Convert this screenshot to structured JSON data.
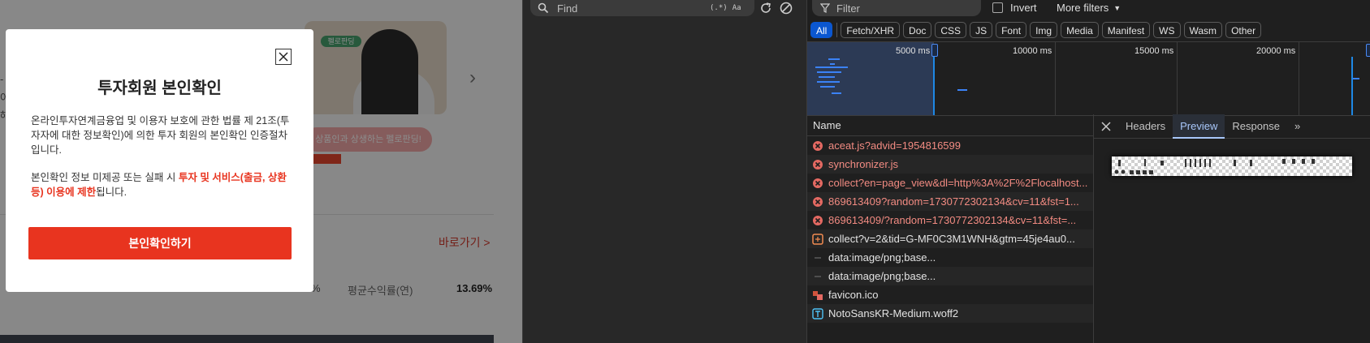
{
  "web": {
    "nav_arrow": "›",
    "banner_tag": "펠로판딩",
    "banner_pill": "상품인과 상생하는 펠로판딩!",
    "left_fragments": [
      "-",
      "어",
      "해"
    ],
    "go_link": "바로가기 >",
    "percent_fragment": "%",
    "avg_return_label": "평균수익률(연)",
    "avg_return_value": "13.69%",
    "modal": {
      "title": "투자회원 본인확인",
      "para1": "온라인투자연계금융업 및 이용자 보호에 관한 법률 제 21조(투자자에 대한 정보확인)에 의한 투자 회원의 본인확인 인증절차입니다.",
      "para2_pre": "본인확인 정보 미제공 또는 실패 시 ",
      "para2_highlight": "투자 및 서비스(출금, 상환 등) 이용에 제한",
      "para2_post": "됩니다.",
      "confirm_button": "본인확인하기",
      "accent_color": "#e8341f"
    }
  },
  "search_panel": {
    "find_placeholder": "Find",
    "regex_label": "(.*)",
    "case_label": "Aa"
  },
  "network": {
    "filter_placeholder": "Filter",
    "invert_label": "Invert",
    "more_filters_label": "More filters",
    "types": [
      "All",
      "Fetch/XHR",
      "Doc",
      "CSS",
      "JS",
      "Font",
      "Img",
      "Media",
      "Manifest",
      "WS",
      "Wasm",
      "Other"
    ],
    "active_type": "All",
    "timeline_labels": [
      "5000 ms",
      "10000 ms",
      "15000 ms",
      "20000 ms"
    ],
    "name_header": "Name",
    "requests": [
      {
        "name": "aceat.js?advid=1954816599",
        "status": "error"
      },
      {
        "name": "synchronizer.js",
        "status": "error"
      },
      {
        "name": "collect?en=page_view&dl=http%3A%2F%2Flocalhost...",
        "status": "error"
      },
      {
        "name": "869613409?random=1730772302134&cv=11&fst=1...",
        "status": "error"
      },
      {
        "name": "869613409/?random=1730772302134&cv=11&fst=...",
        "status": "error"
      },
      {
        "name": "collect?v=2&tid=G-MF0C3M1WNH&gtm=45je4au0...",
        "status": "fetch"
      },
      {
        "name": "data:image/png;base...",
        "status": "data"
      },
      {
        "name": "data:image/png;base...",
        "status": "data"
      },
      {
        "name": "favicon.ico",
        "status": "image"
      },
      {
        "name": "NotoSansKR-Medium.woff2",
        "status": "font"
      }
    ],
    "detail_tabs": [
      "Headers",
      "Preview",
      "Response"
    ],
    "active_detail_tab": "Preview",
    "more_tabs_icon": "»"
  }
}
